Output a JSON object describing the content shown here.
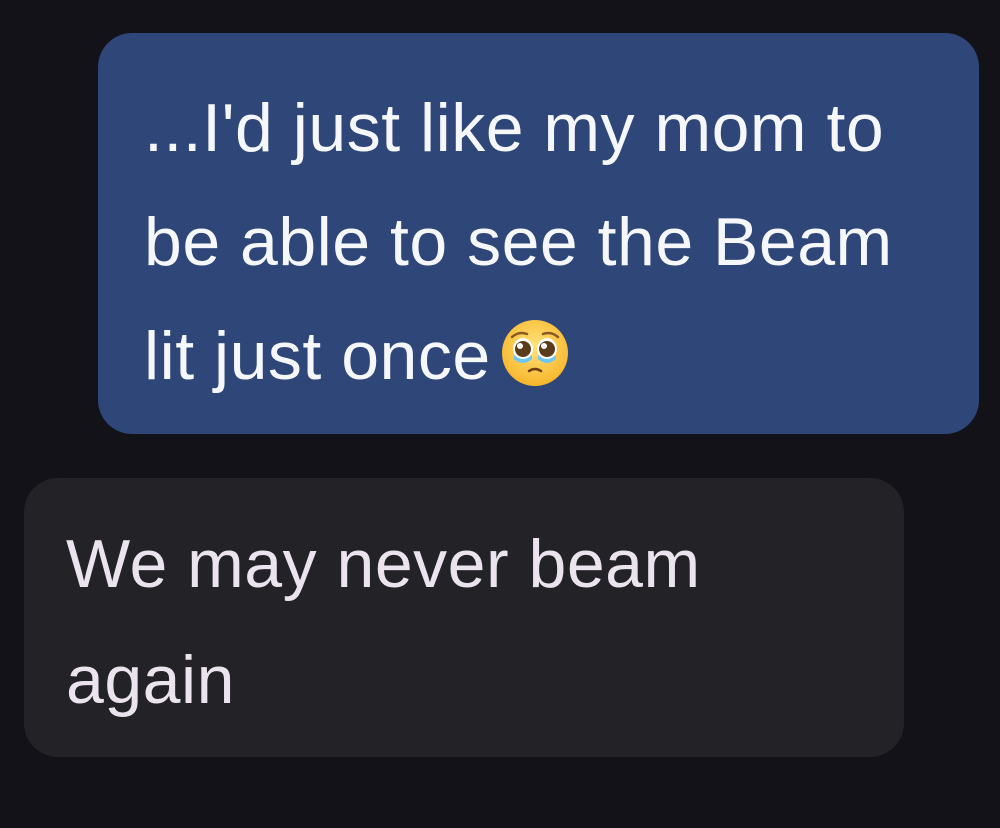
{
  "messages": [
    {
      "direction": "outgoing",
      "text": "...I'd just like my mom to be able to see the Beam lit just once",
      "emoji": "pleading-face-with-tears-icon"
    },
    {
      "direction": "incoming",
      "text": "We may never beam again"
    }
  ],
  "colors": {
    "background": "#121218",
    "outgoing_bubble": "#2e4778",
    "incoming_bubble": "#222227",
    "outgoing_text": "#f6f7fb",
    "incoming_text": "#ebe4ef"
  }
}
